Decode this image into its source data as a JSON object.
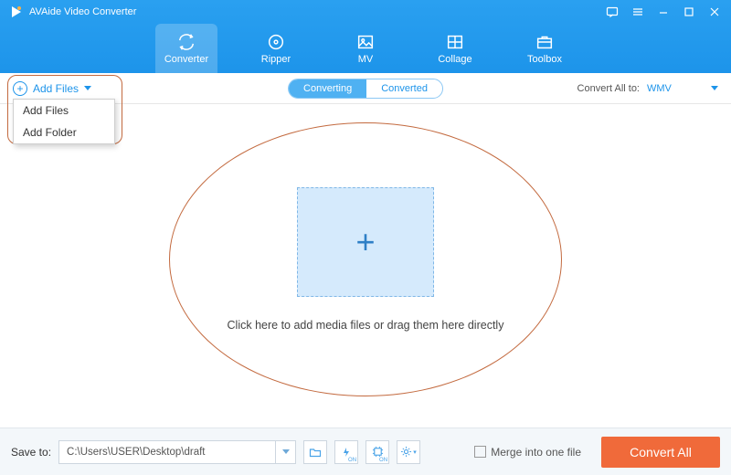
{
  "app": {
    "title": "AVAide Video Converter"
  },
  "nav": [
    "Converter",
    "Ripper",
    "MV",
    "Collage",
    "Toolbox"
  ],
  "addFiles": {
    "label": "Add Files",
    "menu": [
      "Add Files",
      "Add Folder"
    ]
  },
  "tabs": {
    "converting": "Converting",
    "converted": "Converted"
  },
  "convertAll": {
    "label": "Convert All to:",
    "value": "WMV"
  },
  "dropHint": "Click here to add media files or drag them here directly",
  "footer": {
    "saveTo": "Save to:",
    "path": "C:\\Users\\USER\\Desktop\\draft",
    "merge": "Merge into one file",
    "convert": "Convert All"
  },
  "miniBtns": {
    "hw": "ON",
    "gpu": "ON"
  }
}
